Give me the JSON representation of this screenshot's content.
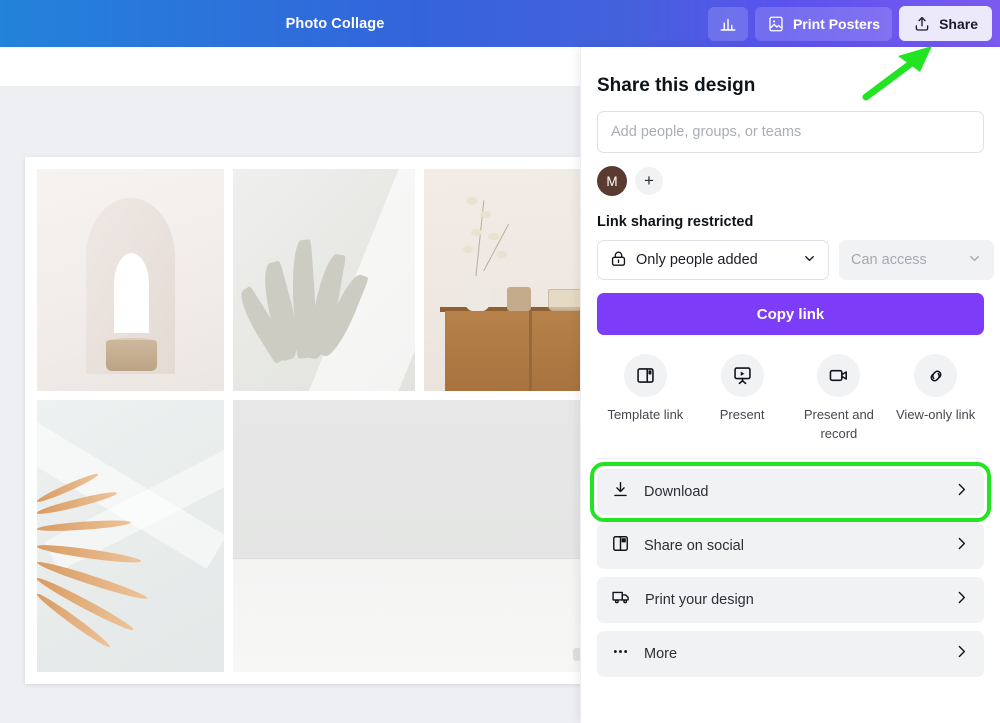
{
  "topbar": {
    "document_title": "Photo Collage",
    "analytics_icon": "bar-chart-icon",
    "print_posters_label": "Print Posters",
    "print_posters_icon": "image-icon",
    "share_label": "Share",
    "share_icon": "upload-icon",
    "gradient_start": "#2283da",
    "gradient_mid": "#4561dc",
    "gradient_end": "#7b5af0",
    "share_button_bg": "#ece9fb"
  },
  "share_panel": {
    "title": "Share this design",
    "people_input": {
      "value": "",
      "placeholder": "Add people, groups, or teams"
    },
    "avatar_initial": "M",
    "avatar_color": "#5b3a31",
    "add_person_label": "+",
    "link_status": "Link sharing restricted",
    "access": {
      "permission_value": "Only people added",
      "permission_icon": "lock-icon",
      "role_value": "Can access",
      "chevron_icon": "chevron-down-icon"
    },
    "copy_link_label": "Copy link",
    "copy_link_color": "#7d3cf8",
    "quick_actions": [
      {
        "label": "Template link",
        "icon": "template-link-icon"
      },
      {
        "label": "Present",
        "icon": "present-icon"
      },
      {
        "label": "Present and record",
        "icon": "video-camera-icon"
      },
      {
        "label": "View-only link",
        "icon": "chain-link-icon"
      }
    ],
    "menu_items": [
      {
        "label": "Download",
        "icon": "download-icon",
        "chevron": "chevron-right-icon",
        "highlighted": true
      },
      {
        "label": "Share on social",
        "icon": "social-grid-icon",
        "chevron": "chevron-right-icon",
        "highlighted": false
      },
      {
        "label": "Print your design",
        "icon": "delivery-truck-icon",
        "chevron": "chevron-right-icon",
        "highlighted": false
      },
      {
        "label": "More",
        "icon": "ellipsis-icon",
        "chevron": "chevron-right-icon",
        "highlighted": false
      }
    ]
  },
  "annotation": {
    "arrow_color": "#22e422",
    "highlight_color": "#22e422"
  },
  "canvas": {
    "collage_cells": [
      {
        "name": "arch-photo"
      },
      {
        "name": "leaf-shadow-photo"
      },
      {
        "name": "wooden-cabinet-photo"
      },
      {
        "name": "pampas-grass-photo"
      },
      {
        "name": "vase-with-flowers-photo"
      }
    ]
  }
}
